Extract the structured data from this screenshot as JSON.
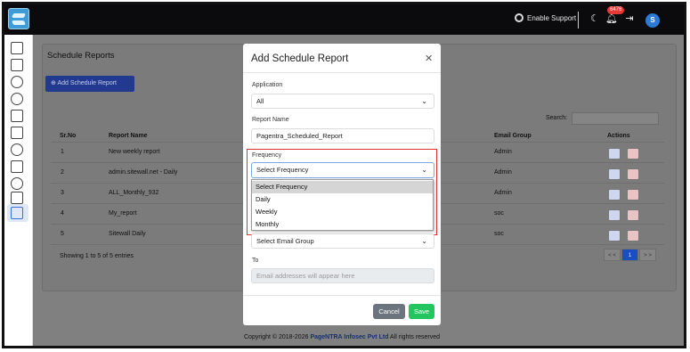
{
  "topbar": {
    "enable_support": "Enable Support",
    "notification_count": "6476",
    "avatar_initial": "S"
  },
  "page": {
    "title": "Schedule Reports",
    "add_button": "Add Schedule Report",
    "search_label": "Search:",
    "table": {
      "headers": [
        "Sr.No",
        "Report Name",
        "Email Group",
        "Actions"
      ],
      "rows": [
        {
          "no": "1",
          "name": "New weekly report",
          "group": "Admin"
        },
        {
          "no": "2",
          "name": "admin.sitewall.net - Daily",
          "group": "Admin"
        },
        {
          "no": "3",
          "name": "ALL_Monthly_932",
          "group": "Admin"
        },
        {
          "no": "4",
          "name": "My_report",
          "group": "soc"
        },
        {
          "no": "5",
          "name": "Sitewall Daily",
          "group": "soc"
        }
      ]
    },
    "showing": "Showing 1 to 5 of 5 entries",
    "pager": {
      "prev": "< <",
      "current": "1",
      "next": "> >"
    }
  },
  "footer": {
    "prefix": "Copyright © 2018-2026",
    "company": "PageNTRA Infosec Pvt Ltd",
    "suffix": "All rights reserved"
  },
  "modal": {
    "title": "Add Schedule Report",
    "application": {
      "label": "Application",
      "value": "All"
    },
    "report_name": {
      "label": "Report Name",
      "value": "Pagentra_Scheduled_Report"
    },
    "frequency": {
      "label": "Frequency",
      "value": "Select Frequency",
      "options": [
        "Select Frequency",
        "Daily",
        "Weekly",
        "Monthly"
      ]
    },
    "email_group": {
      "value": "Select Email Group"
    },
    "to": {
      "label": "To",
      "placeholder": "Email addresses will appear here"
    },
    "cancel": "Cancel",
    "save": "Save"
  },
  "colors": {
    "accent": "#2a7ad6",
    "highlight_border": "#e03030",
    "save": "#22c55e",
    "cancel": "#6c757d"
  }
}
